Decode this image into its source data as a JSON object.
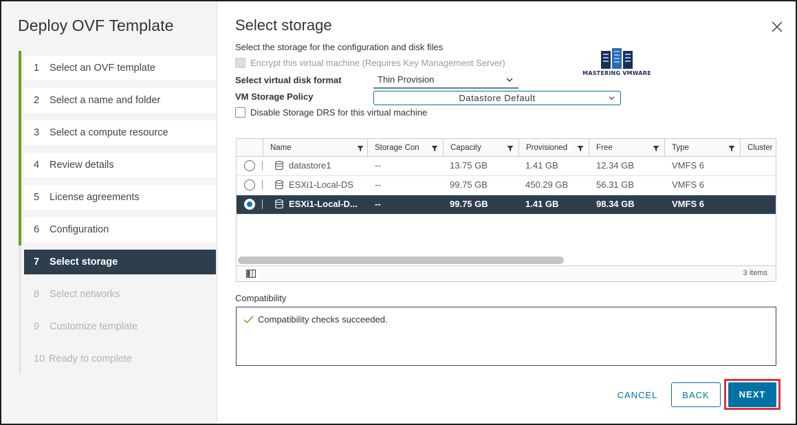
{
  "wizard": {
    "title": "Deploy OVF Template",
    "steps": [
      {
        "num": "1",
        "label": "Select an OVF template",
        "state": "done"
      },
      {
        "num": "2",
        "label": "Select a name and folder",
        "state": "done"
      },
      {
        "num": "3",
        "label": "Select a compute resource",
        "state": "done"
      },
      {
        "num": "4",
        "label": "Review details",
        "state": "done"
      },
      {
        "num": "5",
        "label": "License agreements",
        "state": "done"
      },
      {
        "num": "6",
        "label": "Configuration",
        "state": "done"
      },
      {
        "num": "7",
        "label": "Select storage",
        "state": "active"
      },
      {
        "num": "8",
        "label": "Select networks",
        "state": "disabled"
      },
      {
        "num": "9",
        "label": "Customize template",
        "state": "disabled"
      },
      {
        "num": "10",
        "label": "Ready to complete",
        "state": "disabled"
      }
    ]
  },
  "main": {
    "title": "Select storage",
    "subtitle": "Select the storage for the configuration and disk files",
    "encrypt_label": "Encrypt this virtual machine (Requires Key Management Server)",
    "disk_format_label": "Select virtual disk format",
    "disk_format_value": "Thin Provision",
    "storage_policy_label": "VM Storage Policy",
    "storage_policy_value": "Datastore Default",
    "disable_drs_label": "Disable Storage DRS for this virtual machine",
    "logo_text": "MASTERING VMWARE"
  },
  "grid": {
    "columns": [
      "Name",
      "Storage Con",
      "Capacity",
      "Provisioned",
      "Free",
      "Type",
      "Cluster"
    ],
    "rows": [
      {
        "name": "datastore1",
        "storage_con": "--",
        "capacity": "13.75 GB",
        "provisioned": "1.41 GB",
        "free": "12.34 GB",
        "type": "VMFS 6",
        "cluster": "",
        "selected": false
      },
      {
        "name": "ESXi1-Local-DS",
        "storage_con": "--",
        "capacity": "99.75 GB",
        "provisioned": "450.29 GB",
        "free": "56.31 GB",
        "type": "VMFS 6",
        "cluster": "",
        "selected": false
      },
      {
        "name": "ESXi1-Local-D...",
        "storage_con": "--",
        "capacity": "99.75 GB",
        "provisioned": "1.41 GB",
        "free": "98.34 GB",
        "type": "VMFS 6",
        "cluster": "",
        "selected": true
      }
    ],
    "item_count": "3 items"
  },
  "compatibility": {
    "label": "Compatibility",
    "message": "Compatibility checks succeeded."
  },
  "buttons": {
    "cancel": "CANCEL",
    "back": "BACK",
    "next": "NEXT"
  },
  "colors": {
    "active_step_bg": "#2d3e4d",
    "progress_green": "#62a420",
    "primary_blue": "#0072a3",
    "highlight_red": "#d9363e"
  }
}
